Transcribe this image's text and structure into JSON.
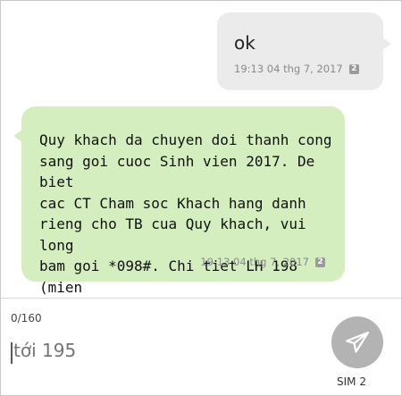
{
  "messages": {
    "outgoing": {
      "text": "ok",
      "timestamp": "19:13 04 thg 7, 2017",
      "sim": "2"
    },
    "incoming": {
      "text": "Quy khach da chuyen doi thanh cong\nsang goi cuoc Sinh vien 2017. De biet\ncac CT Cham soc Khach hang danh\nrieng cho TB cua Quy khach, vui long\nbam goi *098#. Chi tiet LH 198 (mien\nphi). Tran trong.",
      "timestamp": "19:13 04 thg 7, 2017",
      "sim": "2"
    }
  },
  "compose": {
    "char_count": "0/160",
    "placeholder": "tới 195",
    "send_icon": "send-icon",
    "sim_label": "SIM 2"
  },
  "colors": {
    "outgoing_bubble": "#ebebeb",
    "incoming_bubble": "#d4eec0",
    "send_button": "#b3b3b3"
  }
}
